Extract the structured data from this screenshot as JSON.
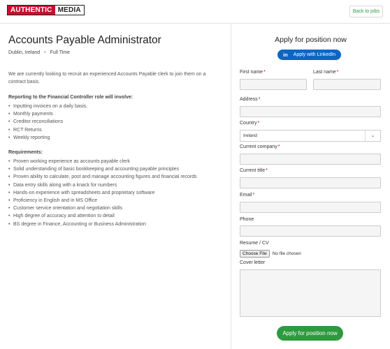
{
  "header": {
    "logo_left": "AUTHENTIC",
    "logo_right": "MEDIA",
    "back_label": "Back to jobs"
  },
  "job": {
    "title": "Accounts Payable Administrator",
    "location": "Dublin, Ireland",
    "separator": "•",
    "type": "Full Time",
    "intro": "We are currently looking to recruit an experienced Accounts Payable clerk to join them on a contract basis.",
    "duties_heading": "Reporting to the Financial Controller role will involve:",
    "duties": [
      "Inputting invoices on a daily basis.",
      "Monthly payments",
      "Creditor reconciliations",
      "RCT Returns",
      "Weekly reporting"
    ],
    "requirements_heading": "Requirements:",
    "requirements": [
      "Proven working experience as accounts payable clerk",
      "Solid understanding of basic bookkeeping and accounting payable principles",
      "Proven ability to calculate, post and manage accounting figures and financial records",
      "Data entry skills along with a knack for numbers",
      "Hands-on experience with spreadsheets and proprietary software",
      "Proficiency in English and in MS Office",
      "Customer service orientation and negotiation skills",
      "High degree of accuracy and attention to detail",
      "BS degree in Finance, Accounting or Business Administration"
    ]
  },
  "form": {
    "title": "Apply for position now",
    "linkedin_icon": "in",
    "linkedin_label": "Apply with LinkedIn",
    "required_mark": "*",
    "first_name_label": "First name",
    "last_name_label": "Last name",
    "address_label": "Address",
    "country_label": "Country",
    "country_value": "Ireland",
    "company_label": "Current company",
    "current_title_label": "Current title",
    "email_label": "Email",
    "phone_label": "Phone",
    "resume_label": "Resume / CV",
    "choose_file_label": "Choose File",
    "no_file_label": "No file chosen",
    "cover_letter_label": "Cover letter",
    "submit_label": "Apply for position now"
  },
  "colors": {
    "brand_red": "#c8102e",
    "accent_green": "#2e9a3e",
    "linkedin_blue": "#0a66c2",
    "required_red": "#d0021b"
  }
}
